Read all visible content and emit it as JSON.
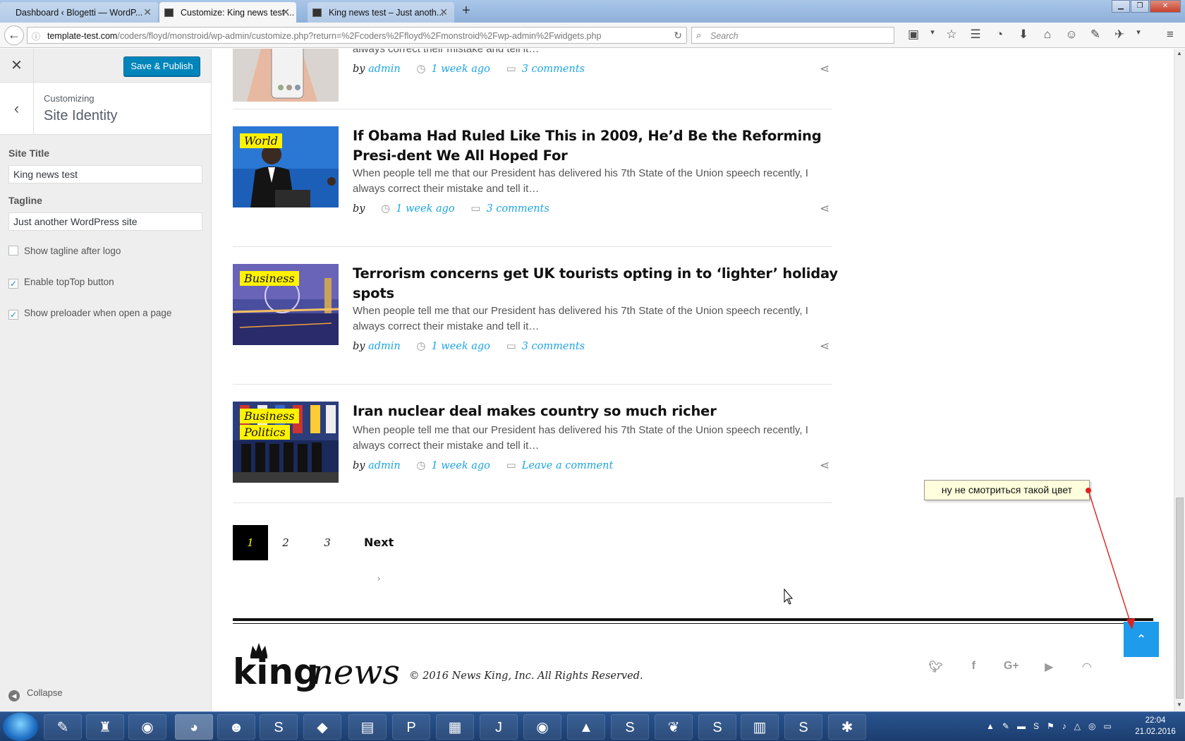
{
  "browser": {
    "tabs": [
      {
        "title": "Dashboard ‹ Blogetti — WordP..."
      },
      {
        "title": "Customize: King news test ..."
      },
      {
        "title": "King news test – Just anoth..."
      }
    ],
    "url_host": "template-test.com",
    "url_path": "/coders/floyd/monstroid/wp-admin/customize.php?return=%2Fcoders%2Ffloyd%2Fmonstroid%2Fwp-admin%2Fwidgets.php",
    "search_placeholder": "Search"
  },
  "customizer": {
    "save_label": "Save & Publish",
    "customizing_label": "Customizing",
    "section_title": "Site Identity",
    "site_title_label": "Site Title",
    "site_title_value": "King news test",
    "tagline_label": "Tagline",
    "tagline_value": "Just another WordPress site",
    "checkboxes": [
      {
        "label": "Show tagline after logo",
        "checked": false
      },
      {
        "label": "Enable topTop button",
        "checked": true
      },
      {
        "label": "Show preloader when open a page",
        "checked": true
      }
    ],
    "collapse_label": "Collapse"
  },
  "posts": [
    {
      "excerpt_tail": "always correct their mistake and tell it…",
      "by": "by",
      "author": "admin",
      "time": "1 week ago",
      "comments": "3 comments"
    },
    {
      "categories": [
        "World"
      ],
      "title": "If Obama Had Ruled Like This in 2009, He’d Be the Reforming Presi-dent We All Hoped For",
      "excerpt": "When people tell me that our President has delivered his 7th State of the Union speech recently, I always correct their mistake and tell it…",
      "by": "by",
      "author": "",
      "time": "1 week ago",
      "comments": "3 comments"
    },
    {
      "categories": [
        "Business"
      ],
      "title": "Terrorism concerns get UK tourists opting in to ‘lighter’ holiday spots",
      "excerpt": "When people tell me that our President has delivered his 7th State of the Union speech recently, I always correct their mistake and tell it…",
      "by": "by",
      "author": "admin",
      "time": "1 week ago",
      "comments": "3 comments"
    },
    {
      "categories": [
        "Business",
        "Politics"
      ],
      "title": "Iran nuclear deal makes country so much richer",
      "excerpt": "When people tell me that our President has delivered his 7th State of the Union speech recently, I always correct their mistake and tell it…",
      "by": "by",
      "author": "admin",
      "time": "1 week ago",
      "comments": "Leave a comment"
    }
  ],
  "pagination": {
    "pages": [
      "1",
      "2",
      "3"
    ],
    "current": "1",
    "next": "Next"
  },
  "footer": {
    "logo_text_a": "king",
    "logo_text_b": "news",
    "copyright": "© 2016 News King, Inc. All Rights Reserved.",
    "socials": [
      "twitter-icon",
      "facebook-icon",
      "google-plus-icon",
      "youtube-icon",
      "rss-icon"
    ]
  },
  "annotation": {
    "text": "ну не смотриться такой цвет",
    "color": "#e02020"
  },
  "colors": {
    "accent_link": "#1ea5e0",
    "badge": "#fff200",
    "totop": "#1e9bea",
    "wp_button": "#0085ba"
  },
  "taskbar": {
    "time": "22:04",
    "date": "21.02.2016"
  }
}
